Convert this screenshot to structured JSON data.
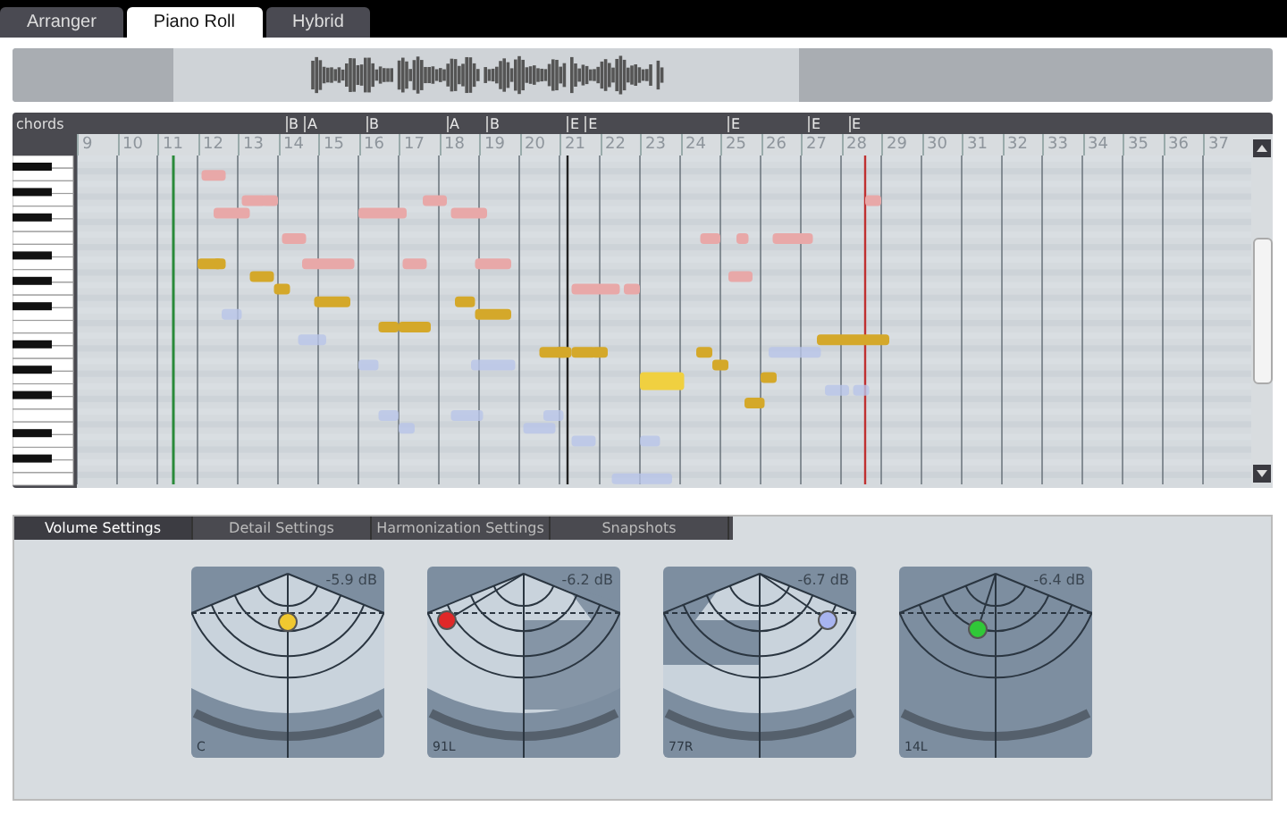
{
  "tabs": [
    {
      "label": "Arranger",
      "selected": false
    },
    {
      "label": "Piano Roll",
      "selected": true
    },
    {
      "label": "Hybrid",
      "selected": false
    }
  ],
  "piano_roll": {
    "chord_lane_label": "chords",
    "bars": [
      {
        "number": "9"
      },
      {
        "number": "10"
      },
      {
        "number": "11"
      },
      {
        "number": "12"
      },
      {
        "number": "13"
      },
      {
        "number": "14",
        "chords": [
          "B",
          "A"
        ]
      },
      {
        "number": "15"
      },
      {
        "number": "16",
        "chords": [
          "B"
        ]
      },
      {
        "number": "17"
      },
      {
        "number": "18",
        "chords": [
          "A"
        ]
      },
      {
        "number": "19",
        "chords": [
          "B"
        ]
      },
      {
        "number": "20"
      },
      {
        "number": "21",
        "chords": [
          "E",
          "E"
        ]
      },
      {
        "number": "22"
      },
      {
        "number": "23"
      },
      {
        "number": "24"
      },
      {
        "number": "25",
        "chords": [
          "E"
        ]
      },
      {
        "number": "26"
      },
      {
        "number": "27",
        "chords": [
          "E"
        ]
      },
      {
        "number": "28",
        "chords": [
          "E"
        ]
      },
      {
        "number": "29"
      },
      {
        "number": "30"
      },
      {
        "number": "31"
      },
      {
        "number": "32"
      },
      {
        "number": "33"
      },
      {
        "number": "34"
      },
      {
        "number": "35"
      },
      {
        "number": "36"
      },
      {
        "number": "37"
      }
    ]
  },
  "settings_tabs": [
    {
      "label": "Volume Settings",
      "selected": true
    },
    {
      "label": "Detail Settings",
      "selected": false
    },
    {
      "label": "Harmonization Settings",
      "selected": false
    },
    {
      "label": "Snapshots",
      "selected": false
    }
  ],
  "panners": [
    {
      "volume": "-5.9 dB",
      "pan": "C",
      "color": "#f0c830"
    },
    {
      "volume": "-6.2 dB",
      "pan": "91L",
      "color": "#e02828"
    },
    {
      "volume": "-6.7 dB",
      "pan": "77R",
      "color": "#a8b4f0"
    },
    {
      "volume": "-6.4 dB",
      "pan": "14L",
      "color": "#30c838"
    }
  ]
}
